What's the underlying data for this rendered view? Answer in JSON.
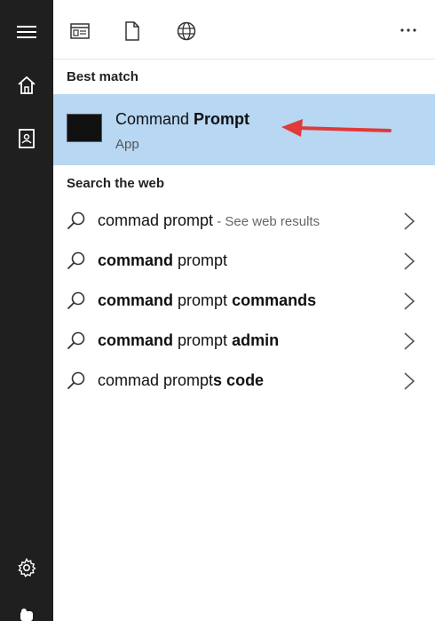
{
  "rail": {
    "icons": [
      "menu-icon",
      "home-icon",
      "notebook-icon",
      "settings-icon",
      "feedback-icon"
    ]
  },
  "toolbar": {
    "filters": [
      "apps-filter-icon",
      "documents-filter-icon",
      "web-filter-icon"
    ],
    "more_label": "···"
  },
  "best_match": {
    "heading": "Best match",
    "title_plain": "Command ",
    "title_bold": "Prompt",
    "subtitle": "App",
    "arrow_color": "#e03a3a"
  },
  "web": {
    "heading": "Search the web",
    "results": [
      {
        "plain1": "commad prompt",
        "bold1": "",
        "plain2": "",
        "bold2": "",
        "hint": " - See web results"
      },
      {
        "plain1": "",
        "bold1": "command",
        "plain2": " prompt",
        "bold2": "",
        "hint": ""
      },
      {
        "plain1": "",
        "bold1": "command",
        "plain2": " prompt ",
        "bold2": "commands",
        "hint": ""
      },
      {
        "plain1": "",
        "bold1": "command",
        "plain2": " prompt ",
        "bold2": "admin",
        "hint": ""
      },
      {
        "plain1": "commad prompt",
        "bold1": "",
        "plain2": "",
        "bold2": "s code",
        "hint": ""
      }
    ]
  },
  "colors": {
    "rail_bg": "#1f1f1f",
    "highlight_bg": "#b7d7f2"
  }
}
